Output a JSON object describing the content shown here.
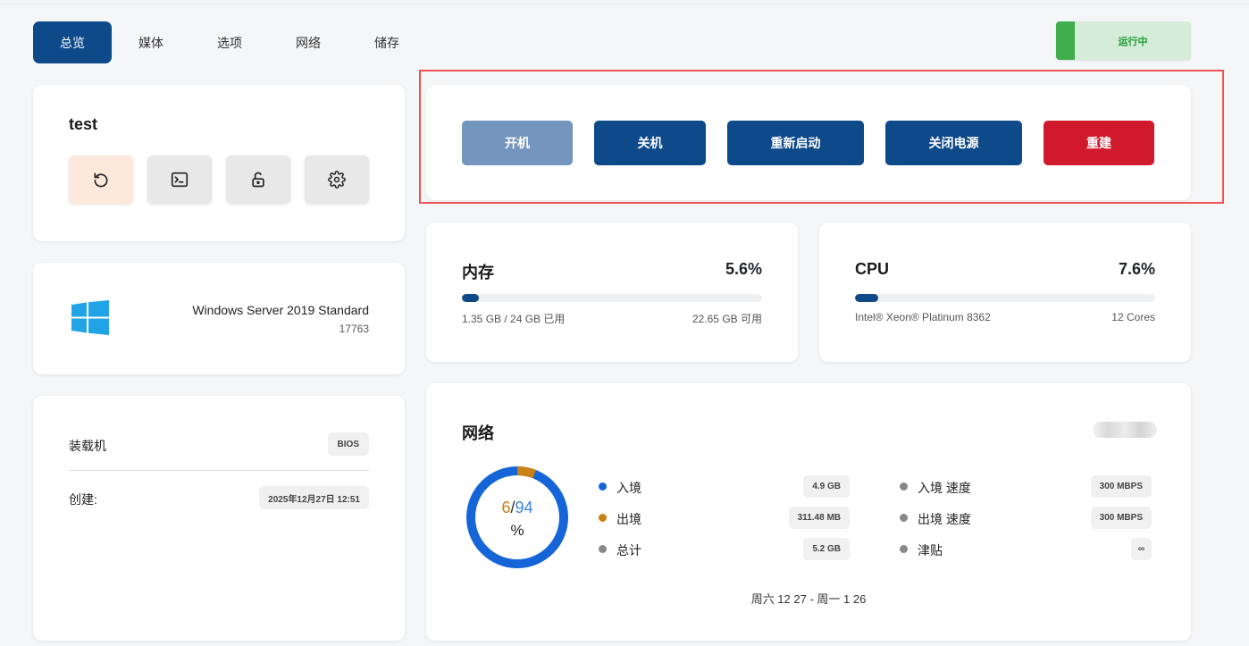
{
  "tabs": [
    {
      "label": "总览",
      "active": true
    },
    {
      "label": "媒体"
    },
    {
      "label": "选项"
    },
    {
      "label": "网络"
    },
    {
      "label": "储存"
    }
  ],
  "status": {
    "label": "运行中",
    "color": "#3fae4d"
  },
  "server": {
    "name": "test",
    "actions": [
      "restart-icon",
      "terminal-icon",
      "lock-open-icon",
      "gear-icon"
    ]
  },
  "os": {
    "name": "Windows Server 2019 Standard",
    "build": "17763",
    "logo": "windows-logo"
  },
  "details": {
    "template_label": "装载机",
    "template_value": "BIOS",
    "created_label": "创建:",
    "created_value": "2025年12月27日 12:51"
  },
  "power": {
    "start": "开机",
    "shutdown": "关机",
    "reboot": "重新启动",
    "poweroff": "关闭电源",
    "rebuild": "重建"
  },
  "memory": {
    "title": "内存",
    "percent": "5.6%",
    "fraction": 0.056,
    "used": "1.35 GB / 24 GB 已用",
    "free": "22.65 GB 可用"
  },
  "cpu": {
    "title": "CPU",
    "percent": "7.6%",
    "fraction": 0.076,
    "model": "Intel® Xeon® Platinum 8362",
    "cores": "12 Cores"
  },
  "network": {
    "title": "网络",
    "donut": {
      "out_pct": "6",
      "sep": "/",
      "in_pct": "94",
      "unit": "%"
    },
    "stats": [
      {
        "label": "入境",
        "value": "4.9 GB",
        "color": "#1565d8"
      },
      {
        "label": "出境",
        "value": "311.48 MB",
        "color": "#c98115"
      },
      {
        "label": "总计",
        "value": "5.2 GB",
        "color": "#888888"
      }
    ],
    "speeds": [
      {
        "label": "入境 速度",
        "value": "300 MBPS"
      },
      {
        "label": "出境 速度",
        "value": "300 MBPS"
      },
      {
        "label": "津贴",
        "value": "∞"
      }
    ],
    "period": "周六 12 27 - 周一 1 26"
  }
}
